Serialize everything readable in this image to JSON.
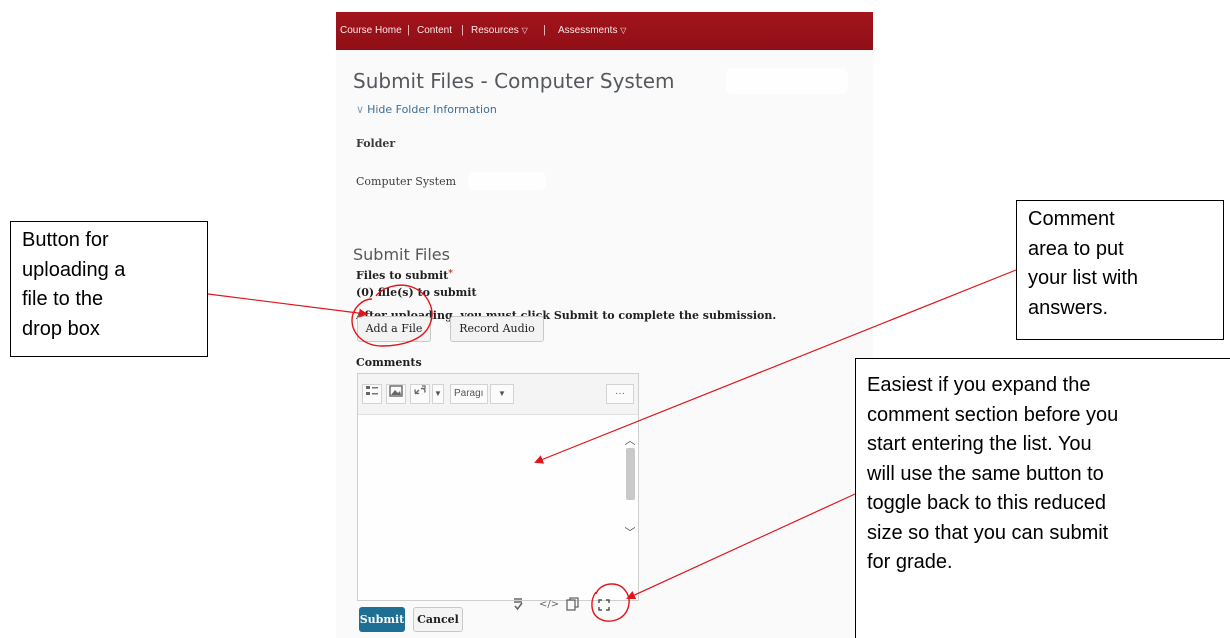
{
  "nav": {
    "items": [
      "Course Home",
      "Content",
      "Resources",
      "Assessments"
    ],
    "dropdown_glyph": "▽"
  },
  "page": {
    "title": "Submit Files - Computer System",
    "hide_folder_link": "Hide Folder Information",
    "folder_label": "Folder",
    "folder_value": "Computer System",
    "section_title": "Submit Files",
    "files_label": "Files to submit",
    "files_count": "(0) file(s) to submit",
    "instruction": "After uploading, you must click Submit to complete the submission.",
    "add_file_button": "Add a File",
    "record_audio_button": "Record Audio",
    "comments_label": "Comments",
    "paragraph_select": "Paragı",
    "more_button": "···",
    "submit_button": "Submit",
    "cancel_button": "Cancel"
  },
  "callouts": {
    "left": "Button for\nuploading a\nfile to the\ndrop box",
    "right": "Comment\narea to put\nyour list with\nanswers.",
    "bottom": "Easiest if you expand the\ncomment section before you\nstart entering the list.  You\nwill use the same button to\ntoggle back to this reduced\nsize so that you can submit\nfor grade."
  },
  "colors": {
    "navbar": "#9c1219",
    "annotation": "#e0141a",
    "submit_button": "#1d6f93",
    "link": "#3f6f96"
  },
  "icons": [
    "chevron-down-icon",
    "insert-stuff-icon",
    "image-icon",
    "link-icon",
    "caret-down-icon",
    "scroll-up-icon",
    "scroll-down-icon",
    "spellcheck-icon",
    "code-view-icon",
    "preview-icon",
    "fullscreen-icon"
  ]
}
